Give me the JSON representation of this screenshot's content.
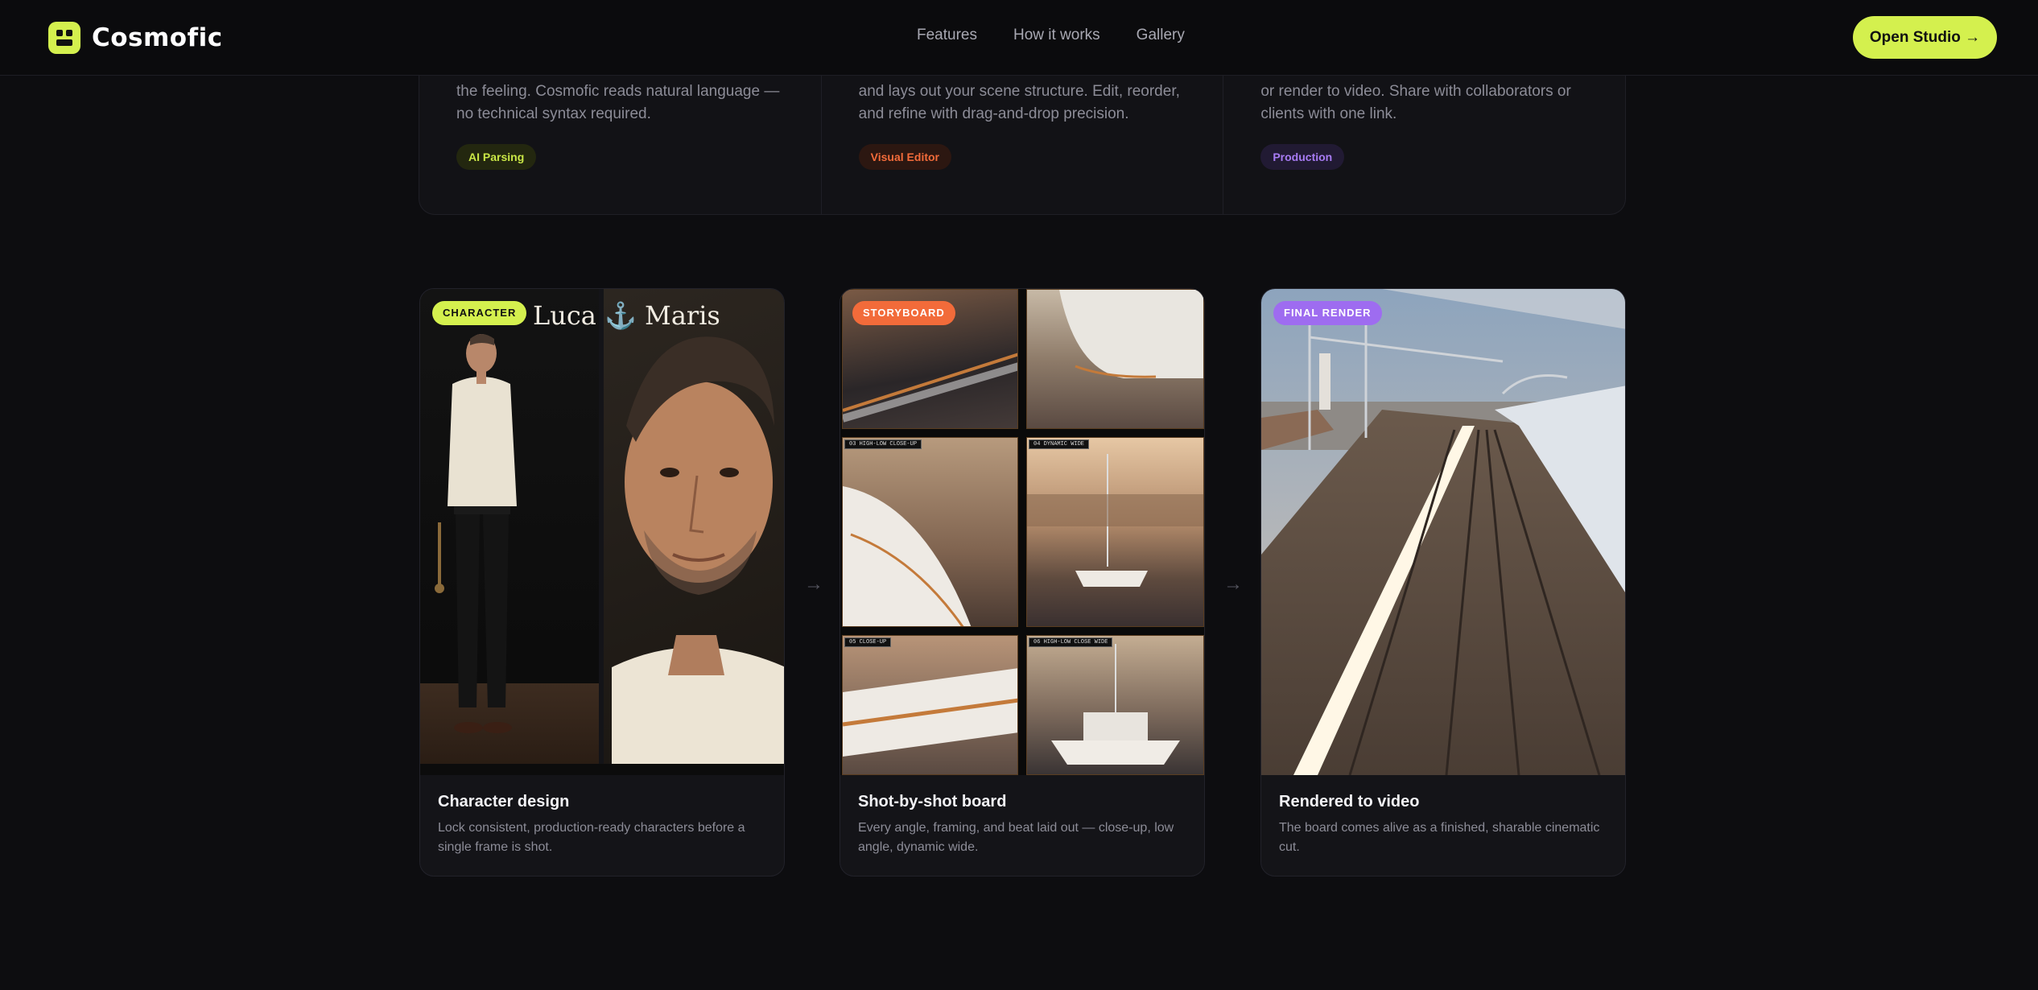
{
  "brand": {
    "name": "Cosmofic"
  },
  "nav": {
    "links": [
      {
        "label": "Features"
      },
      {
        "label": "How it works"
      },
      {
        "label": "Gallery"
      }
    ],
    "cta_label": "Open Studio →"
  },
  "features": [
    {
      "text": "the feeling. Cosmofic reads natural language —\nno technical syntax required.",
      "tag": "AI Parsing"
    },
    {
      "text": "and lays out your scene structure. Edit, reorder,\nand refine with drag-and-drop precision.",
      "tag": "Visual Editor"
    },
    {
      "text": "or render to video. Share with collaborators or\nclients with one link.",
      "tag": "Production"
    }
  ],
  "cards": [
    {
      "badge": "CHARACTER",
      "image_title": "Luca ⚓ Maris",
      "title": "Character design",
      "desc": "Lock consistent, production-ready characters before a single frame is shot."
    },
    {
      "badge": "STORYBOARD",
      "panel_labels": [
        "03 HIGH-LOW CLOSE-UP",
        "04 DYNAMIC WIDE",
        "05 CLOSE-UP",
        "06 HIGH-LOW CLOSE WIDE"
      ],
      "title": "Shot-by-shot board",
      "desc": "Every angle, framing, and beat laid out — close-up, low angle, dynamic wide."
    },
    {
      "badge": "FINAL RENDER",
      "title": "Rendered to video",
      "desc": "The board comes alive as a finished, sharable cinematic cut."
    }
  ],
  "arrows": [
    "→",
    "→"
  ]
}
